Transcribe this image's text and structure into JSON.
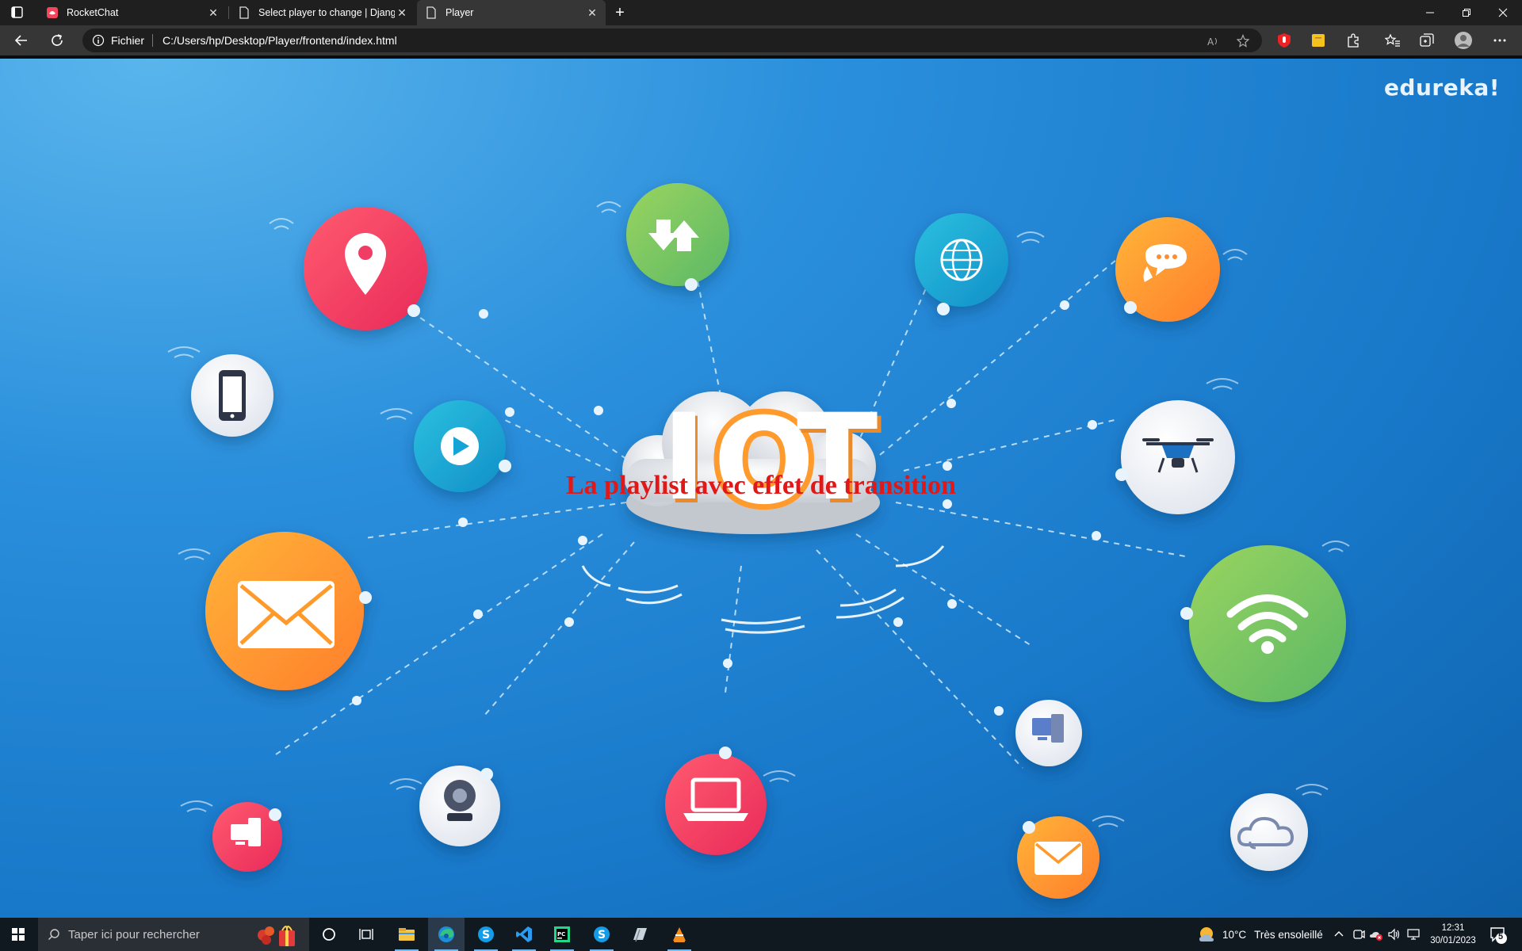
{
  "browser": {
    "tabs": [
      {
        "title": "RocketChat",
        "icon": "rocketchat-icon",
        "close": "✕"
      },
      {
        "title": "Select player to change | Django",
        "icon": "page-icon",
        "close": "✕"
      },
      {
        "title": "Player",
        "icon": "page-icon",
        "close": "✕",
        "active": true
      }
    ],
    "new_tab": "+",
    "address": {
      "protocol": "Fichier",
      "url": "C:/Users/hp/Desktop/Player/frontend/index.html"
    }
  },
  "page": {
    "brand": "edureka!",
    "cloud_text": "IOT",
    "headline": "La playlist avec effet de transition",
    "icons": [
      "location-pin-icon",
      "download-upload-icon",
      "globe-icon",
      "chat-bubble-icon",
      "smartphone-icon",
      "play-icon",
      "drone-icon",
      "mail-icon",
      "wifi-icon",
      "webcam-icon",
      "laptop-icon",
      "desktop-computer-icon",
      "mail-icon",
      "cloud-icon",
      "desktop-computer-icon"
    ]
  },
  "taskbar": {
    "search_placeholder": "Taper ici pour rechercher",
    "weather": {
      "temp": "10°C",
      "condition": "Très ensoleillé"
    },
    "clock": {
      "time": "12:31",
      "date": "30/01/2023"
    },
    "notification_count": "5"
  },
  "colors": {
    "headline": "#e01818",
    "pink": "#ef3d63",
    "green": "#7ac65e",
    "cyan": "#1aa6d4",
    "orange": "#ff9a2c"
  }
}
